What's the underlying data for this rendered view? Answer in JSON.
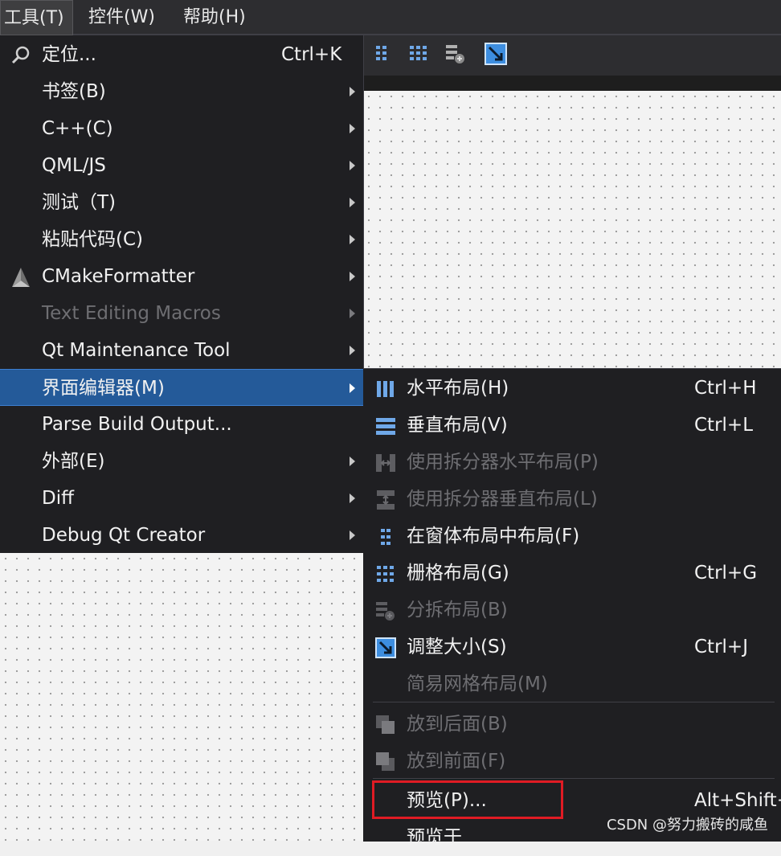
{
  "menubar": {
    "items": [
      {
        "label": "工具(T)",
        "active": true
      },
      {
        "label": "控件(W)"
      },
      {
        "label": "帮助(H)"
      }
    ]
  },
  "toolbar": {
    "icons": [
      "form-layout-icon",
      "grid-layout-icon",
      "splitter-layout-icon",
      "adjust-size-icon"
    ]
  },
  "tools_menu": {
    "items": [
      {
        "label": "定位...",
        "shortcut": "Ctrl+K",
        "icon": "search-icon"
      },
      {
        "label": "书签(B)",
        "submenu": true
      },
      {
        "label": "C++(C)",
        "submenu": true
      },
      {
        "label": "QML/JS",
        "submenu": true
      },
      {
        "label": "测试（T)",
        "submenu": true
      },
      {
        "label": "粘贴代码(C)",
        "submenu": true
      },
      {
        "label": "CMakeFormatter",
        "submenu": true,
        "icon": "cmake-icon"
      },
      {
        "label": "Text Editing Macros",
        "submenu": true,
        "disabled": true
      },
      {
        "label": "Qt Maintenance Tool",
        "submenu": true
      },
      {
        "label": "界面编辑器(M)",
        "submenu": true,
        "highlighted": true
      },
      {
        "label": "Parse Build Output..."
      },
      {
        "label": "外部(E)",
        "submenu": true
      },
      {
        "label": "Diff",
        "submenu": true
      },
      {
        "label": "Debug Qt Creator",
        "submenu": true
      }
    ]
  },
  "form_editor_submenu": {
    "items": [
      {
        "label": "水平布局(H)",
        "shortcut": "Ctrl+H",
        "icon": "horizontal-layout-icon"
      },
      {
        "label": "垂直布局(V)",
        "shortcut": "Ctrl+L",
        "icon": "vertical-layout-icon"
      },
      {
        "label": "使用拆分器水平布局(P)",
        "disabled": true,
        "icon": "horizontal-splitter-icon"
      },
      {
        "label": "使用拆分器垂直布局(L)",
        "disabled": true,
        "icon": "vertical-splitter-icon"
      },
      {
        "label": "在窗体布局中布局(F)",
        "icon": "form-layout-icon"
      },
      {
        "label": "栅格布局(G)",
        "shortcut": "Ctrl+G",
        "icon": "grid-layout-icon"
      },
      {
        "label": "分拆布局(B)",
        "disabled": true,
        "icon": "break-layout-icon"
      },
      {
        "label": "调整大小(S)",
        "shortcut": "Ctrl+J",
        "icon": "adjust-size-icon"
      },
      {
        "label": "简易网格布局(M)",
        "disabled": true
      },
      {
        "label": "放到后面(B)",
        "disabled": true,
        "icon": "send-to-back-icon"
      },
      {
        "label": "放到前面(F)",
        "disabled": true,
        "icon": "bring-to-front-icon"
      },
      {
        "label": "预览(P)...",
        "shortcut": "Alt+Shift+",
        "boxed": true
      },
      {
        "label": "预览于"
      }
    ]
  },
  "watermark": "CSDN @努力搬砖的咸鱼",
  "colors": {
    "menu_bg": "#1f1f22",
    "highlight": "#245a99",
    "disabled_text": "#6e6e72",
    "annotation_box": "#e01b24"
  }
}
